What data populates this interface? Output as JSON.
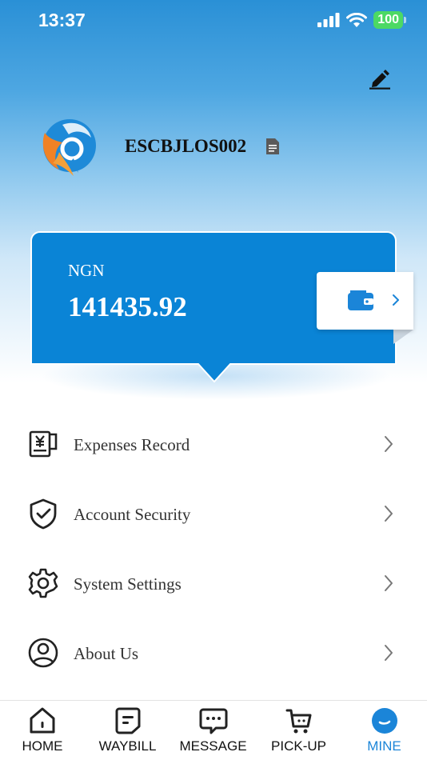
{
  "status_bar": {
    "time": "13:37",
    "battery": "100"
  },
  "profile": {
    "username": "ESCBJLOS002"
  },
  "balance_card": {
    "currency": "NGN",
    "amount": "141435.92"
  },
  "menu": [
    {
      "label": "Expenses Record",
      "icon": "receipt-yen-icon"
    },
    {
      "label": "Account Security",
      "icon": "shield-check-icon"
    },
    {
      "label": "System Settings",
      "icon": "gear-icon"
    },
    {
      "label": "About Us",
      "icon": "person-circle-icon"
    }
  ],
  "tabs": [
    {
      "label": "HOME",
      "icon": "home-icon",
      "active": false
    },
    {
      "label": "WAYBILL",
      "icon": "waybill-icon",
      "active": false
    },
    {
      "label": "MESSAGE",
      "icon": "message-icon",
      "active": false
    },
    {
      "label": "PICK-UP",
      "icon": "cart-icon",
      "active": false
    },
    {
      "label": "MINE",
      "icon": "mine-icon",
      "active": true
    }
  ],
  "colors": {
    "accent": "#1b85d8",
    "card_blue": "#0a84d6",
    "battery_green": "#4cd964"
  }
}
